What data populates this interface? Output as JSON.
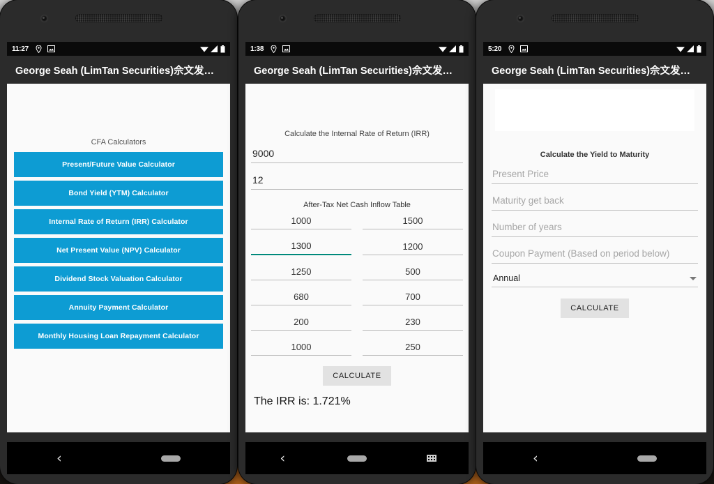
{
  "app": {
    "title": "George Seah (LimTan Securities)佘文发…"
  },
  "icons": {
    "location": "location-pin-icon",
    "screenshot": "screenshot-icon",
    "wifi": "wifi-icon",
    "signal": "signal-bars-icon",
    "battery": "battery-icon",
    "back": "back-nav-icon",
    "home": "home-pill-icon",
    "keyboard": "keyboard-icon",
    "dropdown": "chevron-down-icon"
  },
  "colors": {
    "accent_blue": "#0d9cd3",
    "appbar": "#2b2b2b",
    "statusbar": "#0a0a0a",
    "focus_underline": "#00897b",
    "screen_bg": "#fafafa",
    "button_grey": "#e2e2e2"
  },
  "phone1": {
    "status": {
      "time": "11:27"
    },
    "menu": {
      "title": "CFA Calculators",
      "buttons": [
        "Present/Future Value Calculator",
        "Bond Yield (YTM) Calculator",
        "Internal Rate of Return (IRR) Calculator",
        "Net Present Value (NPV) Calculator",
        "Dividend Stock Valuation Calculator",
        "Annuity Payment Calculator",
        "Monthly Housing Loan Repayment Calculator"
      ]
    },
    "nav": {
      "back": "‹",
      "keyboard_visible": false
    }
  },
  "phone2": {
    "status": {
      "time": "1:38"
    },
    "irr": {
      "title": "Calculate the Internal Rate of Return (IRR)",
      "initial_investment": "9000",
      "periods": "12",
      "table_title": "After-Tax Net Cash Inflow Table",
      "cells": [
        {
          "value": "1000",
          "focused": false
        },
        {
          "value": "1500",
          "focused": false
        },
        {
          "value": "1300",
          "focused": true
        },
        {
          "value": "1200",
          "focused": false
        },
        {
          "value": "1250",
          "focused": false
        },
        {
          "value": "500",
          "focused": false
        },
        {
          "value": "680",
          "focused": false
        },
        {
          "value": "700",
          "focused": false
        },
        {
          "value": "200",
          "focused": false
        },
        {
          "value": "230",
          "focused": false
        },
        {
          "value": "1000",
          "focused": false
        },
        {
          "value": "250",
          "focused": false
        }
      ],
      "calculate_label": "CALCULATE",
      "result": "The IRR is: 1.721%"
    },
    "nav": {
      "back": "‹",
      "keyboard_visible": true
    }
  },
  "phone3": {
    "status": {
      "time": "5:20"
    },
    "ytm": {
      "title": "Calculate the Yield to Maturity",
      "fields": [
        {
          "placeholder": "Present Price",
          "value": ""
        },
        {
          "placeholder": "Maturity get back",
          "value": ""
        },
        {
          "placeholder": "Number of years",
          "value": ""
        },
        {
          "placeholder": "Coupon Payment (Based on period below)",
          "value": ""
        }
      ],
      "period_selected": "Annual",
      "calculate_label": "CALCULATE"
    },
    "nav": {
      "back": "‹",
      "keyboard_visible": false
    }
  }
}
